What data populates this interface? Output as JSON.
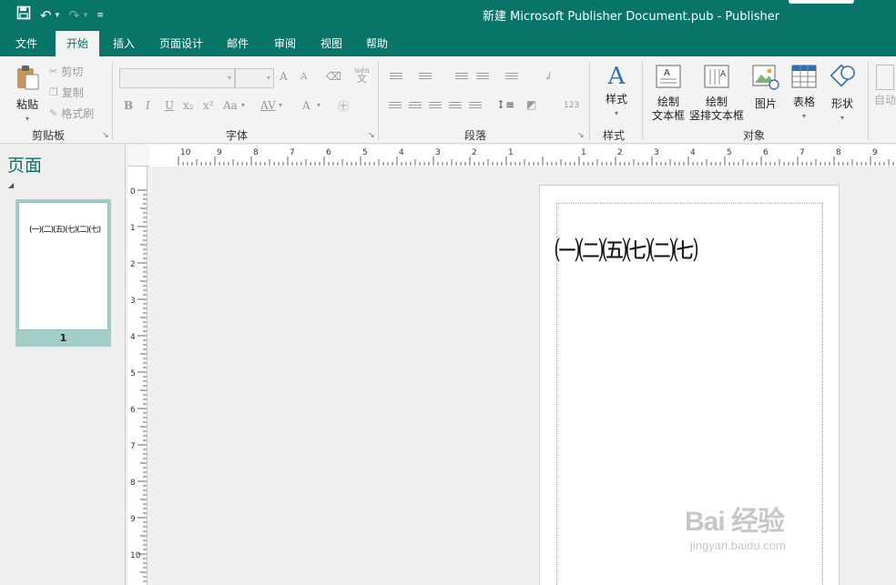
{
  "app": {
    "window_title": "新建 Microsoft Publisher Document.pub  -  Publisher"
  },
  "quick_access": {
    "save_icon": "save-icon",
    "undo_icon": "undo-icon",
    "redo_icon": "redo-icon",
    "customize_icon": "customize-qat-icon"
  },
  "tabs": [
    {
      "label": "文件"
    },
    {
      "label": "开始",
      "active": true
    },
    {
      "label": "插入"
    },
    {
      "label": "页面设计"
    },
    {
      "label": "邮件"
    },
    {
      "label": "审阅"
    },
    {
      "label": "视图"
    },
    {
      "label": "帮助"
    }
  ],
  "ribbon": {
    "clipboard": {
      "label": "剪贴板",
      "paste": "粘贴",
      "cut": "剪切",
      "copy": "复制",
      "format_painter": "格式刷"
    },
    "font": {
      "label": "字体",
      "bold": "B",
      "italic": "I",
      "underline": "U",
      "subscript": "x₂",
      "superscript": "x²",
      "change_case": "Aa",
      "char_spacing": "AV",
      "font_color": "A",
      "grow": "A",
      "shrink": "A",
      "pinyin_top": "wén",
      "pinyin_bottom": "文"
    },
    "paragraph": {
      "label": "段落",
      "numbering_label": "123"
    },
    "styles": {
      "label": "样式",
      "button": "样式"
    },
    "objects": {
      "label": "对象",
      "draw_textbox_line1": "绘制",
      "draw_textbox_line2": "文本框",
      "draw_vertical_line1": "绘制",
      "draw_vertical_line2": "竖排文本框",
      "picture": "图片",
      "table": "表格",
      "shapes": "形状",
      "overflow": "自动"
    }
  },
  "nav_pane": {
    "title": "页面",
    "thumbnail_text": "(一)(二)(五)(七)(二)(七)",
    "page_number": "1"
  },
  "rulers": {
    "horizontal_labels": [
      "10",
      "9",
      "8",
      "7",
      "6",
      "5",
      "4",
      "3",
      "2",
      "1",
      "",
      "1",
      "2",
      "3",
      "4",
      "5",
      "6",
      "7",
      "8",
      "9"
    ],
    "vertical_labels": [
      "0",
      "1",
      "2",
      "3",
      "4",
      "5",
      "6",
      "7",
      "8",
      "9",
      "10"
    ]
  },
  "document": {
    "text": "㈠㈡㈤㈦㈡㈦"
  },
  "watermark": {
    "main": "Bai 经验",
    "sub": "jingyan.baidu.com"
  },
  "colors": {
    "accent": "#077568",
    "ribbon_bg": "#f3f3f3",
    "workspace_bg": "#efefef",
    "thumbnail_selected": "#a4cdc8"
  }
}
